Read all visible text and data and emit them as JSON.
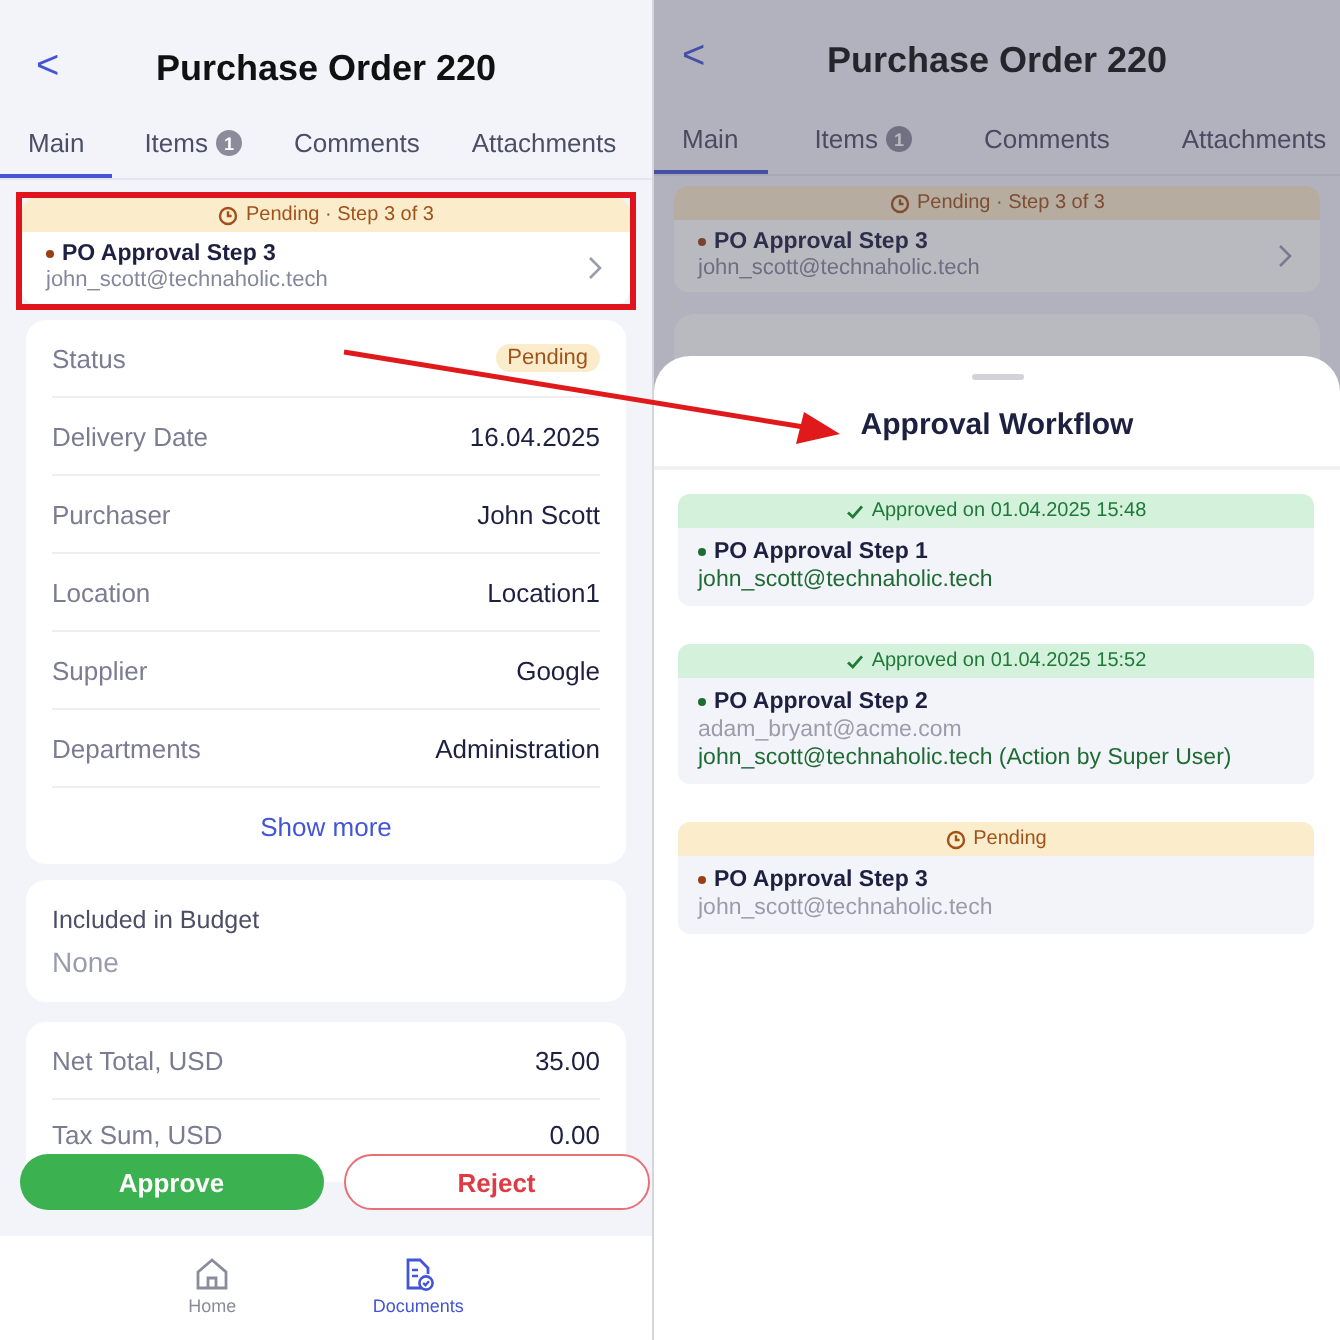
{
  "detail_screen": {
    "back": "<",
    "title": "Purchase Order 220",
    "tabs": [
      {
        "label": "Main",
        "selected": true
      },
      {
        "label": "Items",
        "badge": "1",
        "selected": false
      },
      {
        "label": "Comments",
        "selected": false
      },
      {
        "label": "Attachments",
        "selected": false
      }
    ],
    "approval_card": {
      "kind": "pending",
      "status": "Pending · Step 3 of 3",
      "step": "PO Approval Step 3",
      "email": "john_scott@technaholic.tech",
      "highlighted": true
    },
    "fields": [
      {
        "label": "Status",
        "value": "Pending",
        "kind": "badge"
      },
      {
        "label": "Delivery Date",
        "value": "16.04.2025",
        "kind": "text"
      },
      {
        "label": "Purchaser",
        "value": "John Scott",
        "kind": "text"
      },
      {
        "label": "Location",
        "value": "Location1",
        "kind": "text"
      },
      {
        "label": "Supplier",
        "value": "Google",
        "kind": "text"
      },
      {
        "label": "Departments",
        "value": "Administration",
        "kind": "text"
      }
    ],
    "show_more": "Show more",
    "budget": {
      "label": "Included in Budget",
      "value": "None"
    },
    "totals": [
      {
        "label": "Net Total, USD",
        "value": "35.00"
      },
      {
        "label": "Tax Sum, USD",
        "value": "0.00"
      }
    ],
    "actions": [
      {
        "label": "Approve",
        "kind": "primary"
      },
      {
        "label": "Reject",
        "kind": "danger"
      }
    ],
    "nav": [
      {
        "label": "Home",
        "selected": false
      },
      {
        "label": "Documents",
        "selected": true
      }
    ]
  },
  "workflow_screen": {
    "back": "<",
    "title": "Purchase Order 220",
    "tabs": [
      {
        "label": "Main",
        "selected": true
      },
      {
        "label": "Items",
        "badge": "1",
        "selected": false
      },
      {
        "label": "Comments",
        "selected": false
      },
      {
        "label": "Attachments",
        "selected": false
      }
    ],
    "approval_card": {
      "kind": "pending",
      "status": "Pending · Step 3 of 3",
      "step": "PO Approval Step 3",
      "email": "john_scott@technaholic.tech",
      "highlighted": false
    },
    "sheet": {
      "title": "Approval Workflow",
      "steps": [
        {
          "kind": "approved",
          "status": "Approved on 01.04.2025 15:48",
          "step": "PO Approval Step 1",
          "lines": [
            {
              "text": "john_scott@technaholic.tech",
              "kind": "actor"
            }
          ]
        },
        {
          "kind": "approved",
          "status": "Approved on 01.04.2025 15:52",
          "step": "PO Approval Step 2",
          "lines": [
            {
              "text": "adam_bryant@acme.com",
              "kind": "muted"
            },
            {
              "text": "john_scott@technaholic.tech (Action by Super User)",
              "kind": "actor"
            }
          ]
        },
        {
          "kind": "pending",
          "status": "Pending",
          "step": "PO Approval Step 3",
          "lines": [
            {
              "text": "john_scott@technaholic.tech",
              "kind": "muted"
            }
          ]
        }
      ]
    }
  }
}
